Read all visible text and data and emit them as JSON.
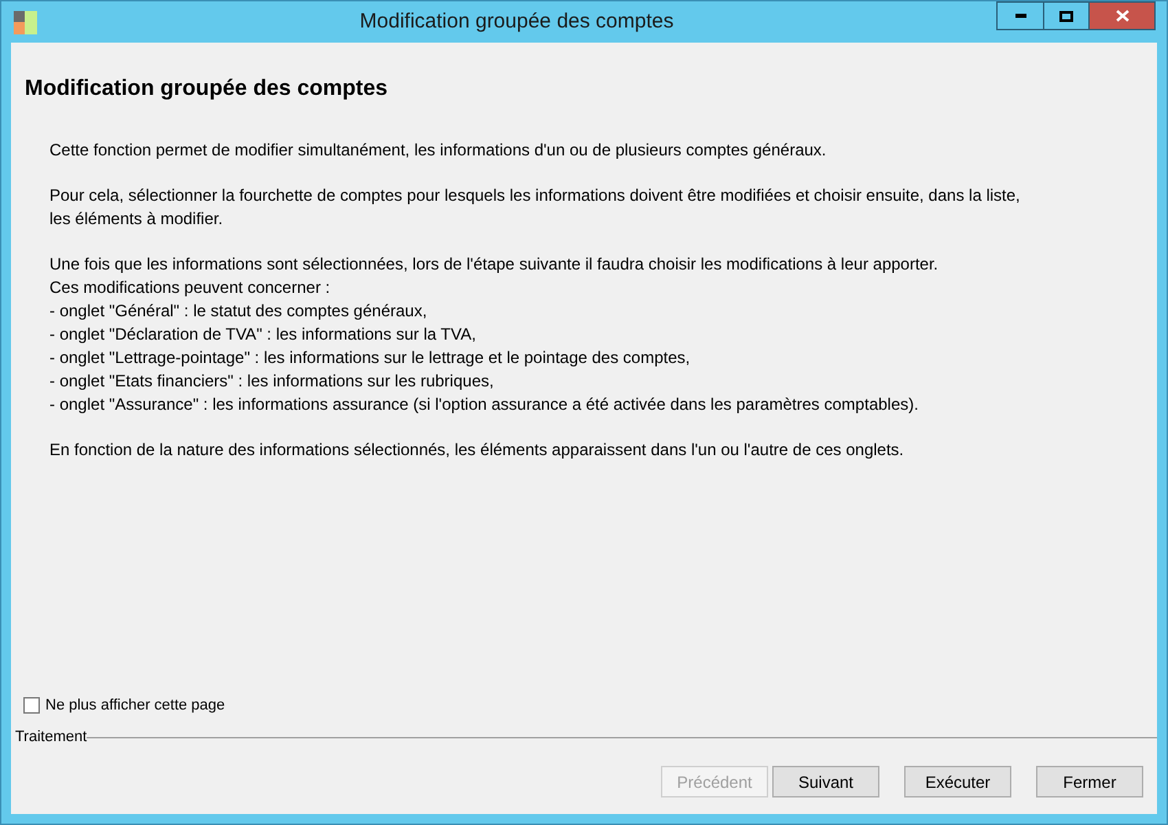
{
  "window": {
    "title": "Modification groupée des comptes"
  },
  "heading": "Modification groupée des comptes",
  "paragraphs": [
    [
      "Cette fonction permet de modifier simultanément, les informations d'un ou de plusieurs comptes généraux."
    ],
    [
      "Pour cela, sélectionner la fourchette de comptes pour lesquels les informations doivent être modifiées et choisir ensuite, dans la liste,",
      "les éléments à modifier."
    ],
    [
      "Une fois que les informations sont sélectionnées, lors de l'étape suivante il faudra choisir les modifications à leur apporter.",
      "Ces modifications peuvent concerner :",
      "- onglet \"Général\" : le statut des comptes généraux,",
      "- onglet \"Déclaration de TVA\" : les informations sur la TVA,",
      "- onglet \"Lettrage-pointage\" : les informations sur le lettrage et le pointage des comptes,",
      "- onglet \"Etats financiers\" : les informations sur les rubriques,",
      "- onglet \"Assurance\" : les informations assurance (si l'option assurance a été activée dans les paramètres comptables)."
    ],
    [
      "En fonction de la nature des informations sélectionnés, les éléments apparaissent dans l'un ou l'autre de ces onglets."
    ]
  ],
  "checkbox": {
    "label": "Ne plus afficher cette page",
    "checked": false
  },
  "group_label": "Traitement",
  "buttons": [
    {
      "label": "Précédent",
      "disabled": true
    },
    {
      "label": "Suivant",
      "disabled": false
    },
    {
      "label": "Exécuter",
      "disabled": false
    },
    {
      "label": "Fermer",
      "disabled": false
    }
  ]
}
